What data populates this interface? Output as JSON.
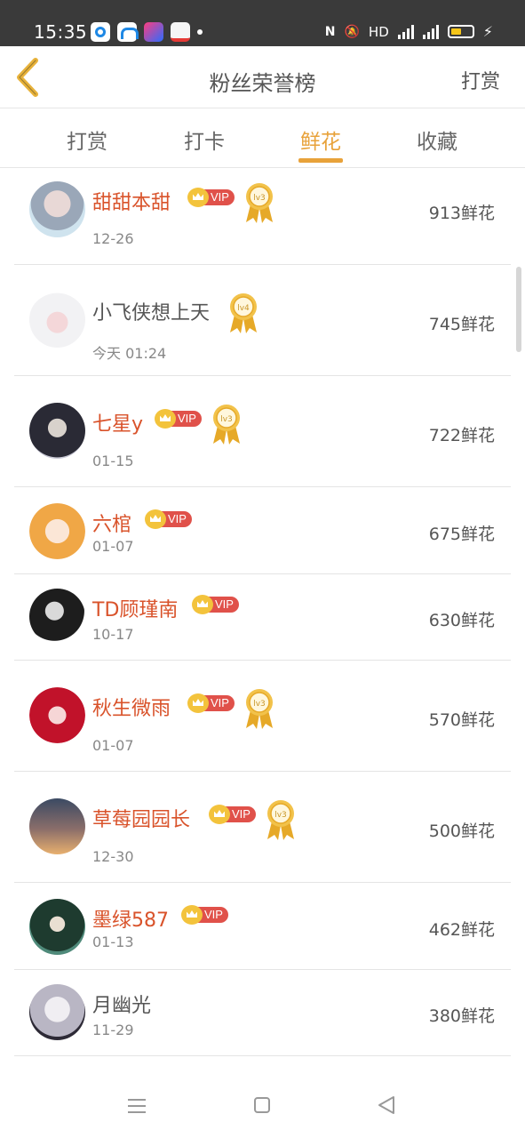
{
  "status_bar": {
    "time": "15:35",
    "hd_label": "HD",
    "net1": "4G",
    "net2": "4G"
  },
  "header": {
    "back_icon": "chevron-left-icon",
    "title": "粉丝荣誉榜",
    "right_action": "打赏",
    "accent_color": "#e8a23a"
  },
  "tabs": [
    {
      "label": "打赏",
      "active": false
    },
    {
      "label": "打卡",
      "active": false
    },
    {
      "label": "鲜花",
      "active": true
    },
    {
      "label": "收藏",
      "active": false
    }
  ],
  "vip_label": "VIP",
  "fans": [
    {
      "name": "甜甜本甜",
      "date": "12-26",
      "vip": true,
      "level": "lv3",
      "count": "913鲜花"
    },
    {
      "name": "小飞侠想上天",
      "date": "今天 01:24",
      "vip": false,
      "level": "lv4",
      "count": "745鲜花"
    },
    {
      "name": "七星y",
      "date": "01-15",
      "vip": true,
      "level": "lv3",
      "count": "722鲜花"
    },
    {
      "name": "六棺",
      "date": "01-07",
      "vip": true,
      "level": "",
      "count": "675鲜花"
    },
    {
      "name": "TD顾瑾南",
      "date": "10-17",
      "vip": true,
      "level": "",
      "count": "630鲜花"
    },
    {
      "name": "秋生微雨",
      "date": "01-07",
      "vip": true,
      "level": "lv3",
      "count": "570鲜花"
    },
    {
      "name": "草莓园园长",
      "date": "12-30",
      "vip": true,
      "level": "lv3",
      "count": "500鲜花"
    },
    {
      "name": "墨绿587",
      "date": "01-13",
      "vip": true,
      "level": "",
      "count": "462鲜花"
    },
    {
      "name": "月幽光",
      "date": "11-29",
      "vip": false,
      "level": "",
      "count": "380鲜花"
    }
  ]
}
